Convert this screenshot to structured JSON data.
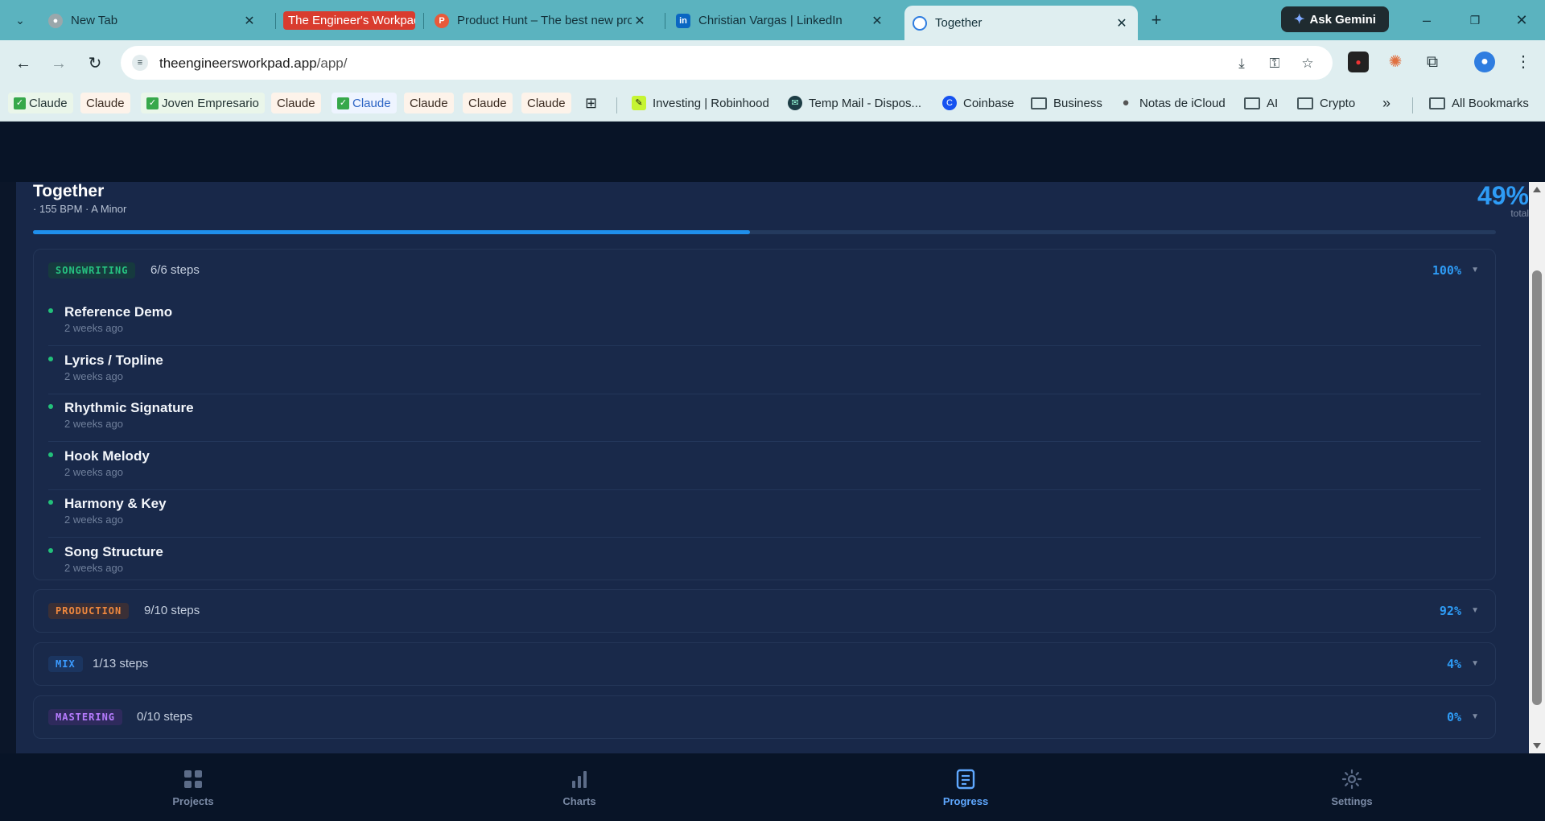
{
  "browser": {
    "tabs": [
      {
        "title": "New Tab",
        "icon": "chrome-icon"
      },
      {
        "title": "The Engineer's Workpad",
        "icon": "workpad-icon"
      },
      {
        "title": "Product Hunt – The best new products",
        "icon": "producthunt-icon"
      },
      {
        "title": "Christian Vargas | LinkedIn",
        "icon": "linkedin-icon"
      },
      {
        "title": "Together",
        "icon": "app-icon"
      }
    ],
    "gemini_label": "Ask Gemini",
    "url_host": "theengineersworkpad.app",
    "url_path": "/app/",
    "bookmarks": [
      {
        "label": "Claude",
        "style": "check"
      },
      {
        "label": "Claude",
        "style": "pill"
      },
      {
        "label": "Joven Empresario",
        "style": "check"
      },
      {
        "label": "Claude",
        "style": "pill"
      },
      {
        "label": "Claude",
        "style": "check-blue"
      },
      {
        "label": "Claude",
        "style": "pill"
      },
      {
        "label": "Claude",
        "style": "pill"
      },
      {
        "label": "Claude",
        "style": "pill"
      },
      {
        "label": "Investing | Robinhood",
        "style": "site"
      },
      {
        "label": "Temp Mail - Dispos...",
        "style": "site"
      },
      {
        "label": "Coinbase",
        "style": "site"
      },
      {
        "label": "Business",
        "style": "folder"
      },
      {
        "label": "Notas de iCloud",
        "style": "site"
      },
      {
        "label": "AI",
        "style": "folder"
      },
      {
        "label": "Crypto",
        "style": "folder"
      }
    ],
    "all_bookmarks_label": "All Bookmarks"
  },
  "project": {
    "title": "Together",
    "meta": "· 155 BPM · A Minor",
    "total_percent": "49%",
    "total_label": "total",
    "progress": 0.49
  },
  "stages": [
    {
      "badge": "SONGWRITING",
      "steps_text": "6/6 steps",
      "percent": "100%",
      "expanded": true,
      "badge_color": "#26c281",
      "badge_bg": "#163a3e",
      "steps": [
        {
          "name": "Reference Demo",
          "time": "2 weeks ago"
        },
        {
          "name": "Lyrics / Topline",
          "time": "2 weeks ago"
        },
        {
          "name": "Rhythmic Signature",
          "time": "2 weeks ago"
        },
        {
          "name": "Hook Melody",
          "time": "2 weeks ago"
        },
        {
          "name": "Harmony & Key",
          "time": "2 weeks ago"
        },
        {
          "name": "Song Structure",
          "time": "2 weeks ago"
        }
      ]
    },
    {
      "badge": "PRODUCTION",
      "steps_text": "9/10 steps",
      "percent": "92%",
      "expanded": false,
      "badge_color": "#f0883e",
      "badge_bg": "#3a2f36"
    },
    {
      "badge": "MIX",
      "steps_text": "1/13 steps",
      "percent": "4%",
      "expanded": false,
      "badge_color": "#3b9bff",
      "badge_bg": "#1b3560"
    },
    {
      "badge": "MASTERING",
      "steps_text": "0/10 steps",
      "percent": "0%",
      "expanded": false,
      "badge_color": "#b77cff",
      "badge_bg": "#2e2a5c"
    }
  ],
  "nav": {
    "items": [
      {
        "label": "Projects",
        "icon": "grid-icon",
        "active": false
      },
      {
        "label": "Charts",
        "icon": "bar-chart-icon",
        "active": false
      },
      {
        "label": "Progress",
        "icon": "document-icon",
        "active": true
      },
      {
        "label": "Settings",
        "icon": "gear-icon",
        "active": false
      }
    ]
  },
  "colors": {
    "accent": "#2e9cf6",
    "complete_dot": "#22c07a",
    "panel": "#182849",
    "page_bg": "#081427"
  }
}
